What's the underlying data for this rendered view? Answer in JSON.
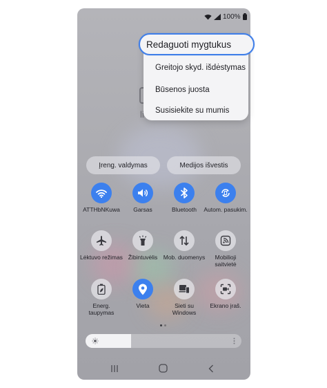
{
  "status_bar": {
    "battery_text": "100%"
  },
  "background": {
    "partial_text": "lie"
  },
  "menu": {
    "highlighted_item": "Redaguoti mygtukus",
    "items": [
      "Greitojo skyd. išdėstymas",
      "Būsenos juosta",
      "Susisiekite su mumis"
    ]
  },
  "panel_buttons": {
    "device_control": "Įreng. valdymas",
    "media_output": "Medijos išvestis"
  },
  "tiles": [
    {
      "label": "ATTHbNKuwa",
      "icon": "wifi-icon",
      "state": "on"
    },
    {
      "label": "Garsas",
      "icon": "sound-icon",
      "state": "on"
    },
    {
      "label": "Bluetooth",
      "icon": "bluetooth-icon",
      "state": "on"
    },
    {
      "label": "Autom. pasukim.",
      "icon": "auto-rotate-icon",
      "state": "on"
    },
    {
      "label": "Lėktuvo režimas",
      "icon": "airplane-icon",
      "state": "off"
    },
    {
      "label": "Žibintuvėlis",
      "icon": "flashlight-icon",
      "state": "off"
    },
    {
      "label": "Mob. duomenys",
      "icon": "mobile-data-icon",
      "state": "off"
    },
    {
      "label": "Mobilioji saitvietė",
      "icon": "hotspot-icon",
      "state": "off"
    },
    {
      "label": "Energ. taupymas",
      "icon": "power-saving-icon",
      "state": "off"
    },
    {
      "label": "Vieta",
      "icon": "location-icon",
      "state": "on"
    },
    {
      "label": "Sieti su Windows",
      "icon": "link-windows-icon",
      "state": "off"
    },
    {
      "label": "Ekrano įraš.",
      "icon": "screen-recorder-icon",
      "state": "off"
    }
  ],
  "pagination": {
    "current_page": 1,
    "total_pages": 2
  },
  "brightness": {
    "level": 0.29
  },
  "colors": {
    "accent": "#3c80ee",
    "highlight_border": "#3f7ee8"
  }
}
